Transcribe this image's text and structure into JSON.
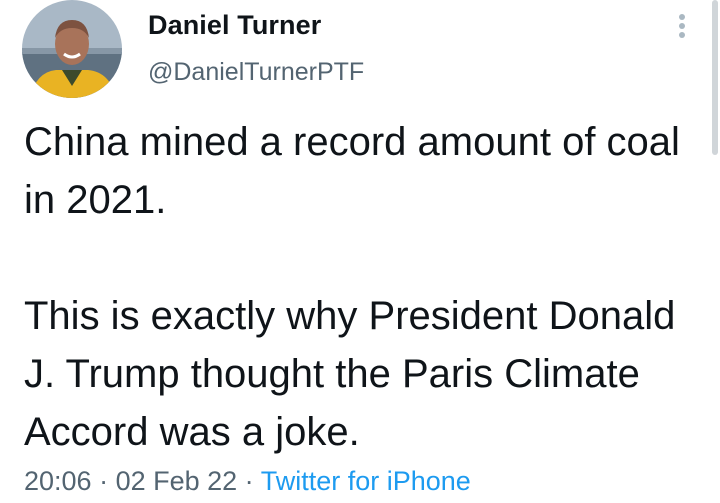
{
  "user": {
    "display_name": "Daniel Turner",
    "handle": "@DanielTurnerPTF"
  },
  "tweet": {
    "paragraph1": "China mined a record amount of coal in 2021.",
    "paragraph2": "This is exactly why President Donald J. Trump thought the Paris Climate Accord was a joke."
  },
  "meta": {
    "time": "20:06",
    "separator1": " · ",
    "date": "02 Feb 22",
    "separator2": " · ",
    "source": "Twitter for iPhone"
  },
  "icons": {
    "more": "more-vertical-icon"
  },
  "colors": {
    "text": "#0f1419",
    "secondary": "#536471",
    "link": "#1d9bf0"
  }
}
